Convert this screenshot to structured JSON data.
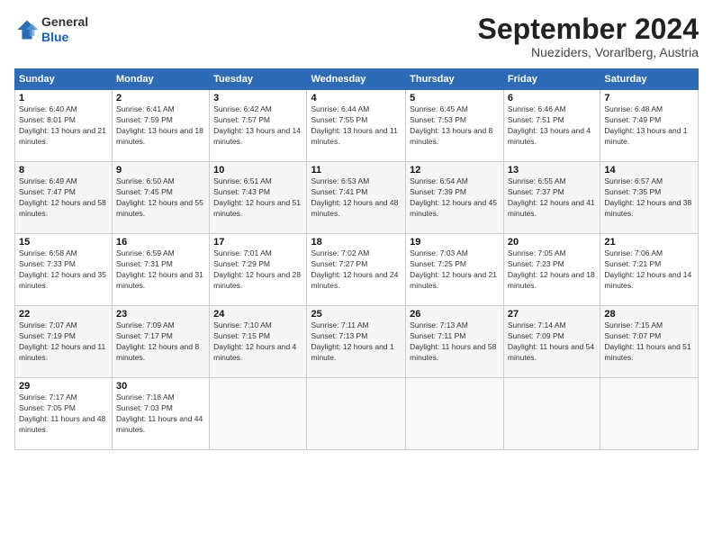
{
  "header": {
    "logo_general": "General",
    "logo_blue": "Blue",
    "month_title": "September 2024",
    "subtitle": "Nueziders, Vorarlberg, Austria"
  },
  "weekdays": [
    "Sunday",
    "Monday",
    "Tuesday",
    "Wednesday",
    "Thursday",
    "Friday",
    "Saturday"
  ],
  "weeks": [
    [
      {
        "day": "1",
        "sunrise": "6:40 AM",
        "sunset": "8:01 PM",
        "daylight": "13 hours and 21 minutes."
      },
      {
        "day": "2",
        "sunrise": "6:41 AM",
        "sunset": "7:59 PM",
        "daylight": "13 hours and 18 minutes."
      },
      {
        "day": "3",
        "sunrise": "6:42 AM",
        "sunset": "7:57 PM",
        "daylight": "13 hours and 14 minutes."
      },
      {
        "day": "4",
        "sunrise": "6:44 AM",
        "sunset": "7:55 PM",
        "daylight": "13 hours and 11 minutes."
      },
      {
        "day": "5",
        "sunrise": "6:45 AM",
        "sunset": "7:53 PM",
        "daylight": "13 hours and 8 minutes."
      },
      {
        "day": "6",
        "sunrise": "6:46 AM",
        "sunset": "7:51 PM",
        "daylight": "13 hours and 4 minutes."
      },
      {
        "day": "7",
        "sunrise": "6:48 AM",
        "sunset": "7:49 PM",
        "daylight": "13 hours and 1 minute."
      }
    ],
    [
      {
        "day": "8",
        "sunrise": "6:49 AM",
        "sunset": "7:47 PM",
        "daylight": "12 hours and 58 minutes."
      },
      {
        "day": "9",
        "sunrise": "6:50 AM",
        "sunset": "7:45 PM",
        "daylight": "12 hours and 55 minutes."
      },
      {
        "day": "10",
        "sunrise": "6:51 AM",
        "sunset": "7:43 PM",
        "daylight": "12 hours and 51 minutes."
      },
      {
        "day": "11",
        "sunrise": "6:53 AM",
        "sunset": "7:41 PM",
        "daylight": "12 hours and 48 minutes."
      },
      {
        "day": "12",
        "sunrise": "6:54 AM",
        "sunset": "7:39 PM",
        "daylight": "12 hours and 45 minutes."
      },
      {
        "day": "13",
        "sunrise": "6:55 AM",
        "sunset": "7:37 PM",
        "daylight": "12 hours and 41 minutes."
      },
      {
        "day": "14",
        "sunrise": "6:57 AM",
        "sunset": "7:35 PM",
        "daylight": "12 hours and 38 minutes."
      }
    ],
    [
      {
        "day": "15",
        "sunrise": "6:58 AM",
        "sunset": "7:33 PM",
        "daylight": "12 hours and 35 minutes."
      },
      {
        "day": "16",
        "sunrise": "6:59 AM",
        "sunset": "7:31 PM",
        "daylight": "12 hours and 31 minutes."
      },
      {
        "day": "17",
        "sunrise": "7:01 AM",
        "sunset": "7:29 PM",
        "daylight": "12 hours and 28 minutes."
      },
      {
        "day": "18",
        "sunrise": "7:02 AM",
        "sunset": "7:27 PM",
        "daylight": "12 hours and 24 minutes."
      },
      {
        "day": "19",
        "sunrise": "7:03 AM",
        "sunset": "7:25 PM",
        "daylight": "12 hours and 21 minutes."
      },
      {
        "day": "20",
        "sunrise": "7:05 AM",
        "sunset": "7:23 PM",
        "daylight": "12 hours and 18 minutes."
      },
      {
        "day": "21",
        "sunrise": "7:06 AM",
        "sunset": "7:21 PM",
        "daylight": "12 hours and 14 minutes."
      }
    ],
    [
      {
        "day": "22",
        "sunrise": "7:07 AM",
        "sunset": "7:19 PM",
        "daylight": "12 hours and 11 minutes."
      },
      {
        "day": "23",
        "sunrise": "7:09 AM",
        "sunset": "7:17 PM",
        "daylight": "12 hours and 8 minutes."
      },
      {
        "day": "24",
        "sunrise": "7:10 AM",
        "sunset": "7:15 PM",
        "daylight": "12 hours and 4 minutes."
      },
      {
        "day": "25",
        "sunrise": "7:11 AM",
        "sunset": "7:13 PM",
        "daylight": "12 hours and 1 minute."
      },
      {
        "day": "26",
        "sunrise": "7:13 AM",
        "sunset": "7:11 PM",
        "daylight": "11 hours and 58 minutes."
      },
      {
        "day": "27",
        "sunrise": "7:14 AM",
        "sunset": "7:09 PM",
        "daylight": "11 hours and 54 minutes."
      },
      {
        "day": "28",
        "sunrise": "7:15 AM",
        "sunset": "7:07 PM",
        "daylight": "11 hours and 51 minutes."
      }
    ],
    [
      {
        "day": "29",
        "sunrise": "7:17 AM",
        "sunset": "7:05 PM",
        "daylight": "11 hours and 48 minutes."
      },
      {
        "day": "30",
        "sunrise": "7:18 AM",
        "sunset": "7:03 PM",
        "daylight": "11 hours and 44 minutes."
      },
      null,
      null,
      null,
      null,
      null
    ]
  ]
}
